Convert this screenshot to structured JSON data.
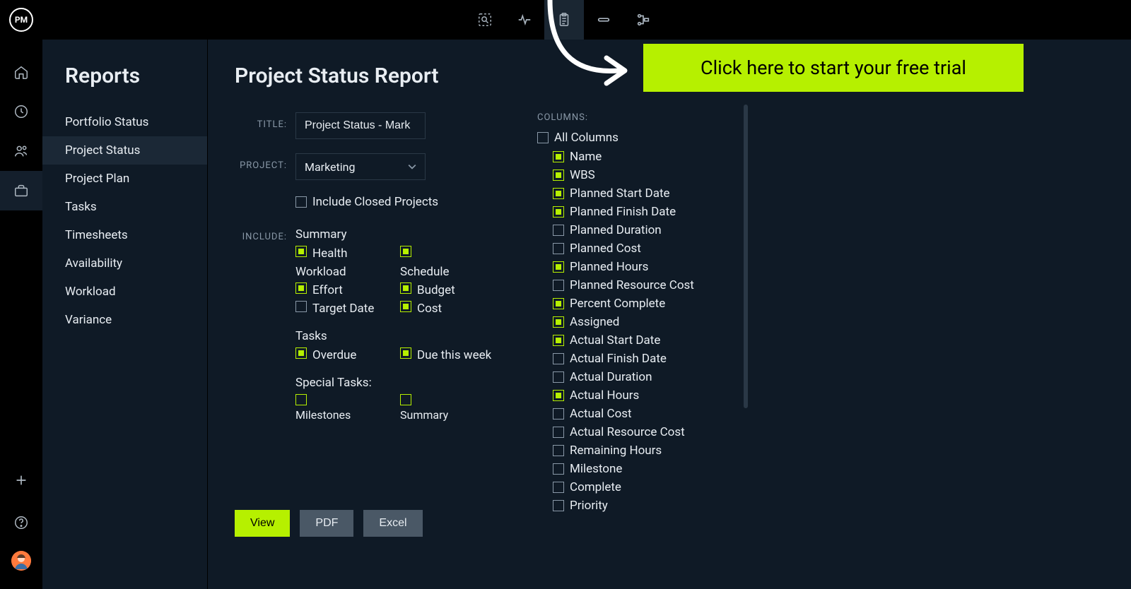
{
  "logo_text": "PM",
  "topbar_icons": [
    "search-icon",
    "pulse-icon",
    "clipboard-icon",
    "link-icon",
    "flow-icon"
  ],
  "sidebar": {
    "title": "Reports",
    "items": [
      "Portfolio Status",
      "Project Status",
      "Project Plan",
      "Tasks",
      "Timesheets",
      "Availability",
      "Workload",
      "Variance"
    ],
    "selected_index": 1
  },
  "page": {
    "title": "Project Status Report",
    "labels": {
      "title": "TITLE:",
      "project": "PROJECT:",
      "include": "INCLUDE:",
      "columns": "COLUMNS:"
    },
    "title_value": "Project Status - Mark",
    "project_value": "Marketing",
    "include_closed": {
      "label": "Include Closed Projects",
      "checked": false
    },
    "include": {
      "summary": {
        "heading": "Summary",
        "items": [
          {
            "label": "Health",
            "checked": true
          },
          {
            "label": "",
            "checked": true
          },
          {
            "label": "Workload",
            "checked": false,
            "text_only": true
          },
          {
            "label": "Schedule",
            "checked": false,
            "text_only": true
          },
          {
            "label": "Effort",
            "checked": true,
            "box": true,
            "paired_box": true,
            "paired_label": "Budget"
          },
          {
            "label": "Target Date",
            "checked": false,
            "paired_box": true,
            "paired_label": "Cost"
          }
        ]
      },
      "tasks": {
        "heading": "Tasks",
        "items": [
          {
            "label": "Overdue",
            "checked": true
          },
          {
            "label": "Due this week",
            "checked": true
          }
        ]
      },
      "special": {
        "heading": "Special Tasks:",
        "items": [
          {
            "label": "Milestones",
            "checked": true
          },
          {
            "label": "Summary",
            "checked": true
          }
        ]
      }
    },
    "columns": {
      "all": {
        "label": "All Columns",
        "checked": false
      },
      "items": [
        {
          "label": "Name",
          "checked": true
        },
        {
          "label": "WBS",
          "checked": true
        },
        {
          "label": "Planned Start Date",
          "checked": true
        },
        {
          "label": "Planned Finish Date",
          "checked": true
        },
        {
          "label": "Planned Duration",
          "checked": false
        },
        {
          "label": "Planned Cost",
          "checked": false
        },
        {
          "label": "Planned Hours",
          "checked": true
        },
        {
          "label": "Planned Resource Cost",
          "checked": false
        },
        {
          "label": "Percent Complete",
          "checked": true
        },
        {
          "label": "Assigned",
          "checked": true
        },
        {
          "label": "Actual Start Date",
          "checked": true
        },
        {
          "label": "Actual Finish Date",
          "checked": false
        },
        {
          "label": "Actual Duration",
          "checked": false
        },
        {
          "label": "Actual Hours",
          "checked": true
        },
        {
          "label": "Actual Cost",
          "checked": false
        },
        {
          "label": "Actual Resource Cost",
          "checked": false
        },
        {
          "label": "Remaining Hours",
          "checked": false
        },
        {
          "label": "Milestone",
          "checked": false
        },
        {
          "label": "Complete",
          "checked": false
        },
        {
          "label": "Priority",
          "checked": false
        }
      ]
    },
    "buttons": {
      "view": "View",
      "pdf": "PDF",
      "excel": "Excel"
    }
  },
  "cta": "Click here to start your free trial"
}
